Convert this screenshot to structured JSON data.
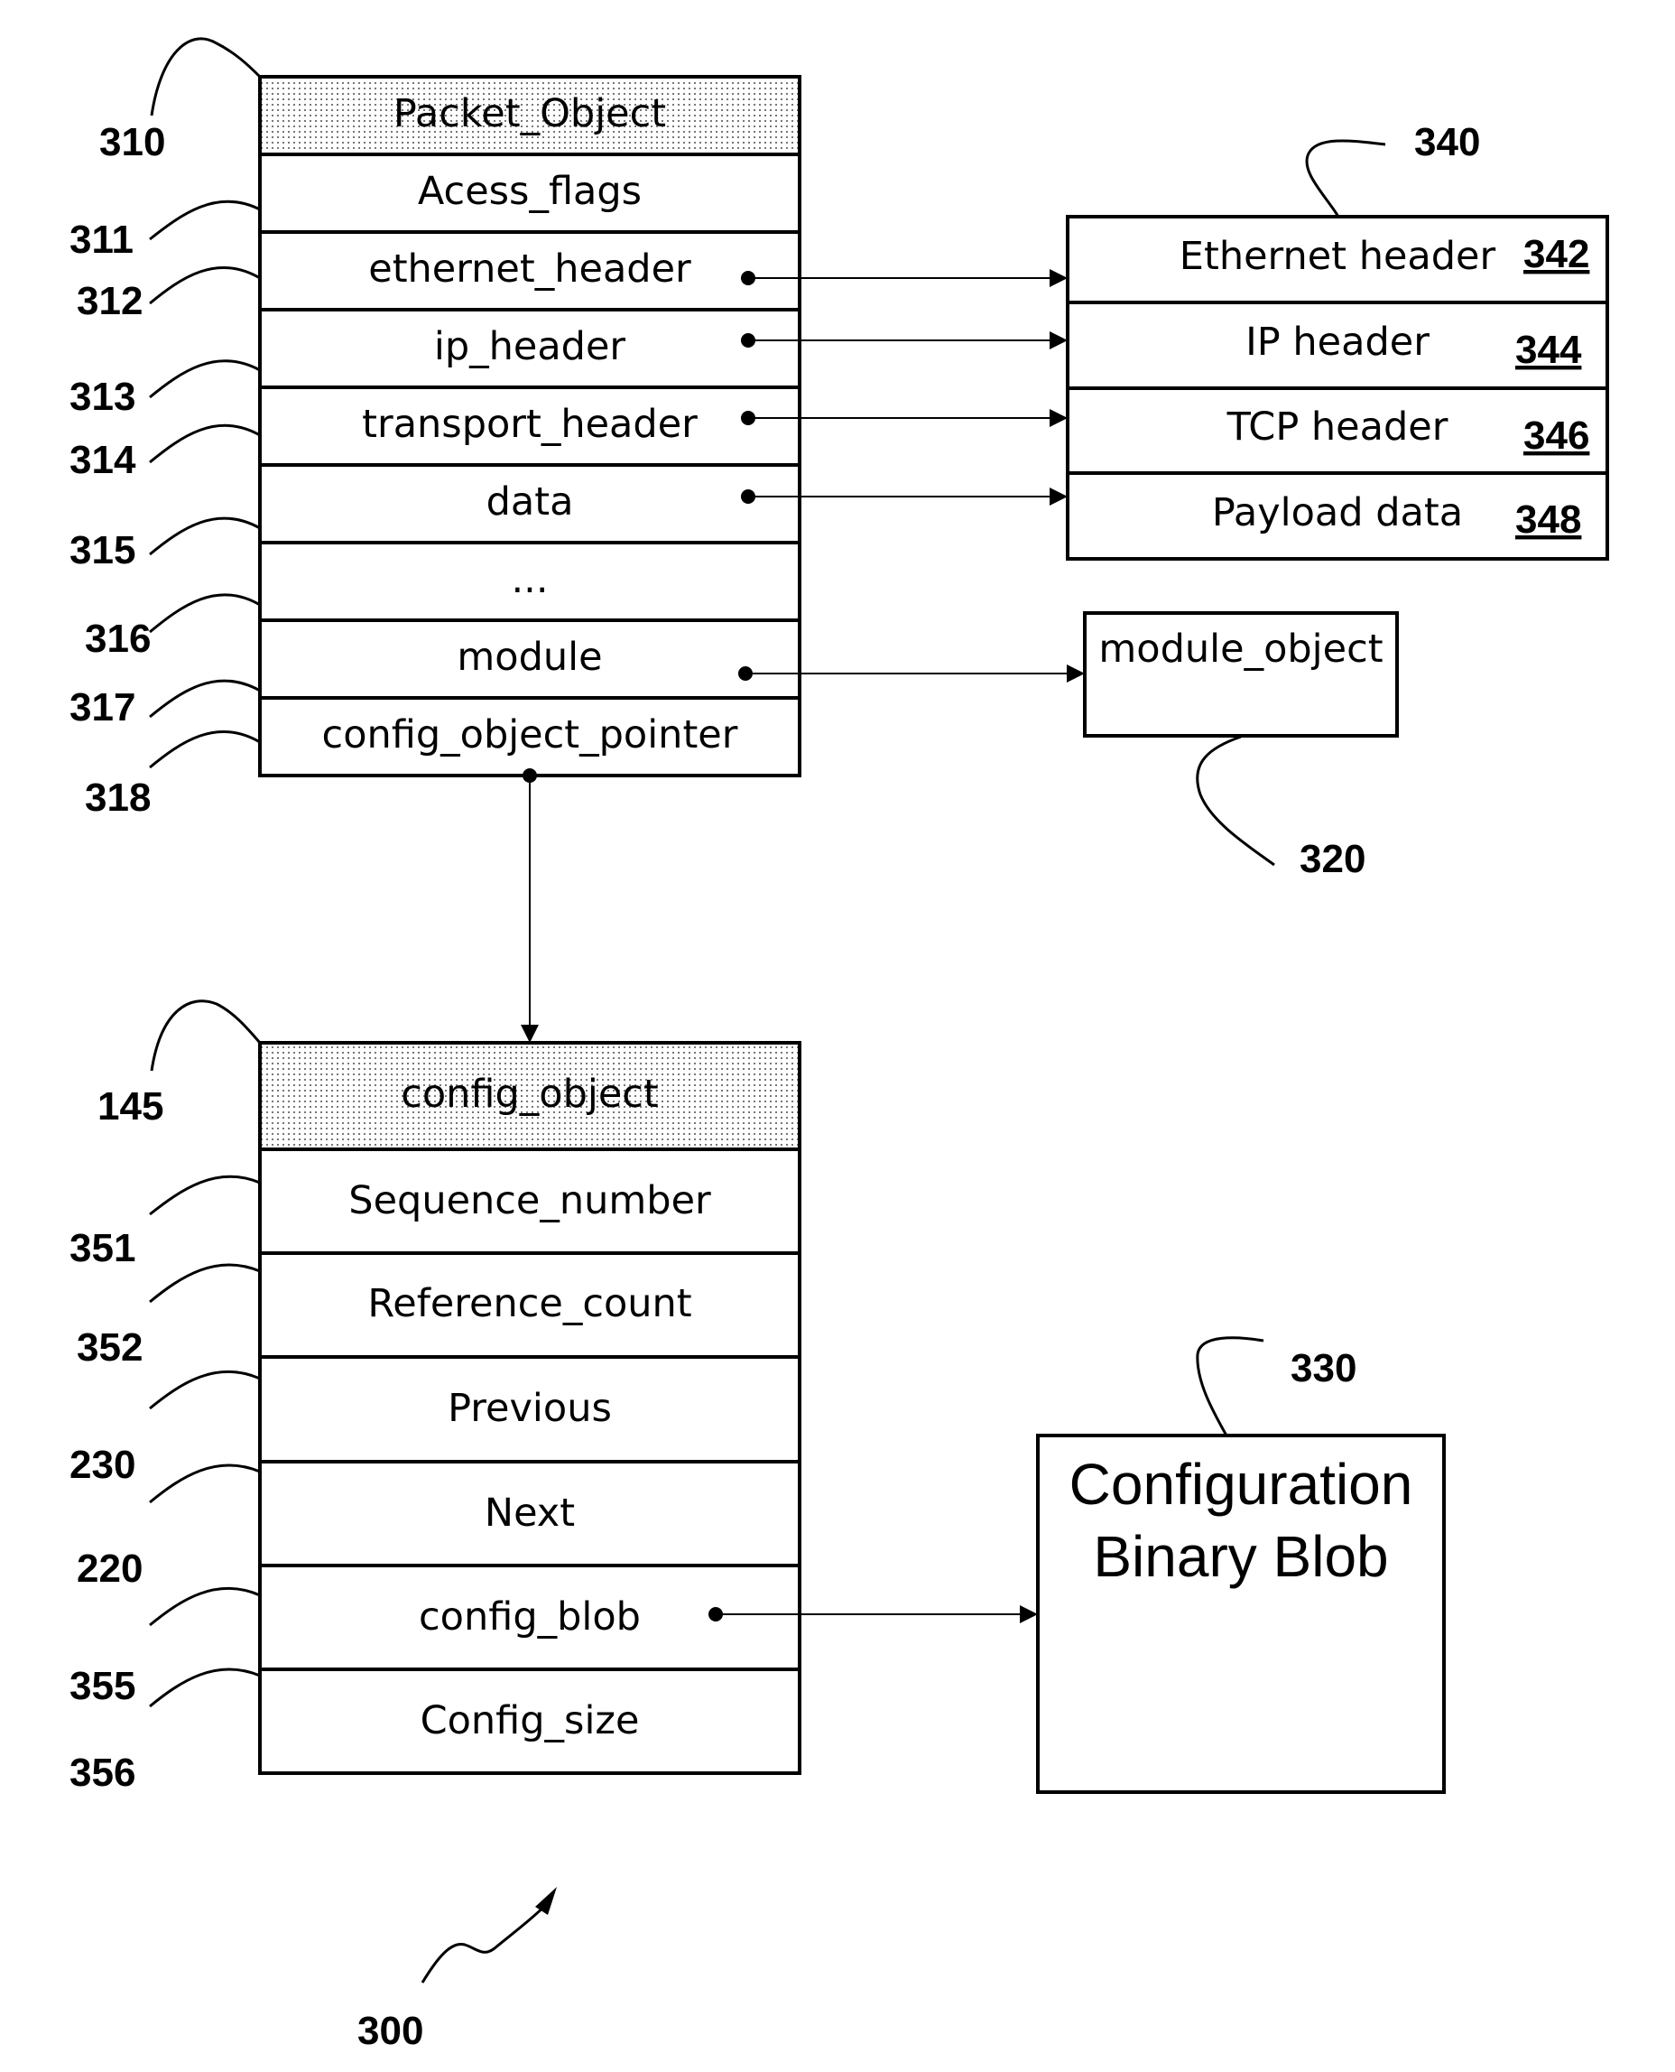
{
  "figure_label": "300",
  "packet_object": {
    "ref": "310",
    "title": "Packet_Object",
    "fields": [
      {
        "label": "Acess_flags",
        "ref": "311",
        "pointer": false
      },
      {
        "label": "ethernet_header",
        "ref": "312",
        "pointer": true
      },
      {
        "label": "ip_header",
        "ref": "313",
        "pointer": true
      },
      {
        "label": "transport_header",
        "ref": "314",
        "pointer": true
      },
      {
        "label": "data",
        "ref": "315",
        "pointer": true
      },
      {
        "label": "...",
        "ref": "316",
        "pointer": false
      },
      {
        "label": "module",
        "ref": "317",
        "pointer": true
      },
      {
        "label": "config_object_pointer",
        "ref": "318",
        "pointer": true
      }
    ]
  },
  "packet_buffer": {
    "ref": "340",
    "rows": [
      {
        "label": "Ethernet header",
        "ref": "342"
      },
      {
        "label": "IP header",
        "ref": "344"
      },
      {
        "label": "TCP header",
        "ref": "346"
      },
      {
        "label": "Payload data",
        "ref": "348"
      }
    ]
  },
  "module_object": {
    "ref": "320",
    "label": "module_object"
  },
  "config_object": {
    "ref": "145",
    "title": "config_object",
    "fields": [
      {
        "label": "Sequence_number",
        "ref": "351",
        "pointer": false
      },
      {
        "label": "Reference_count",
        "ref": "352",
        "pointer": false
      },
      {
        "label": "Previous",
        "ref": "230",
        "pointer": false
      },
      {
        "label": "Next",
        "ref": "220",
        "pointer": false
      },
      {
        "label": "config_blob",
        "ref": "355",
        "pointer": true
      },
      {
        "label": "Config_size",
        "ref": "356",
        "pointer": false
      }
    ]
  },
  "config_blob": {
    "ref": "330",
    "line1": "Configuration",
    "line2": "Binary Blob"
  },
  "colors": {
    "stroke": "#000000",
    "header_fill": "#e8e8e8",
    "background": "#ffffff"
  }
}
